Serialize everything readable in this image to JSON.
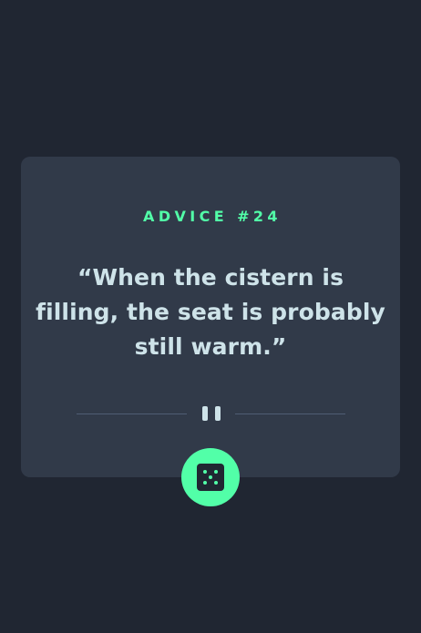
{
  "advice": {
    "label": "ADVICE #",
    "number": "24",
    "quote": "“When the cistern is filling, the seat is probably still warm.”"
  },
  "icons": {
    "divider": "pause-icon",
    "button": "dice-icon"
  },
  "colors": {
    "background": "#202632",
    "card": "#313a49",
    "accent": "#52ffa8",
    "text": "#cee3e9",
    "divider": "#4f5d74"
  }
}
